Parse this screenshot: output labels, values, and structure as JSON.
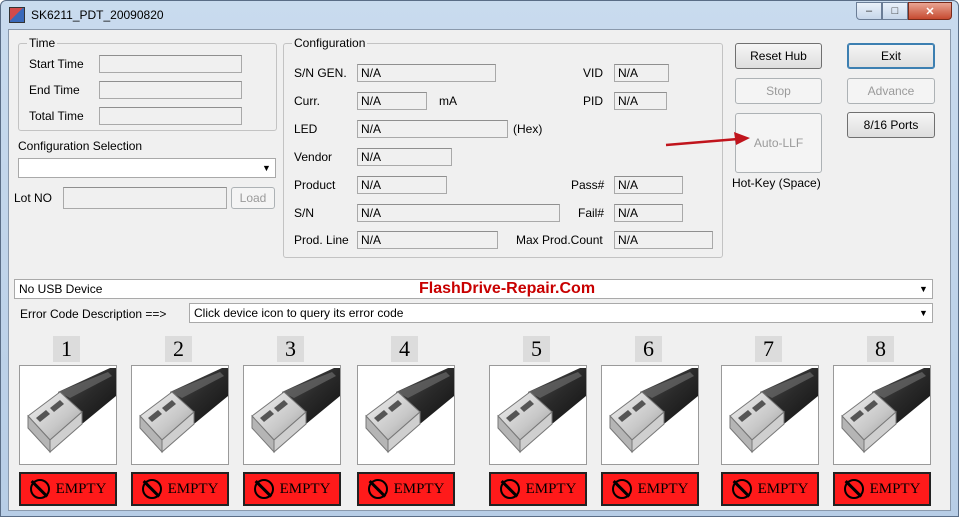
{
  "window": {
    "title": "SK6211_PDT_20090820",
    "minimize": "–",
    "maximize": "□",
    "close": "✕"
  },
  "time": {
    "group_label": "Time",
    "start_label": "Start Time",
    "end_label": "End Time",
    "total_label": "Total Time",
    "start_value": "",
    "end_value": "",
    "total_value": ""
  },
  "config_selection": {
    "label": "Configuration Selection",
    "value": "",
    "lot_label": "Lot NO",
    "lot_value": "",
    "load_button": "Load"
  },
  "configuration": {
    "group_label": "Configuration",
    "sn_gen_label": "S/N GEN.",
    "sn_gen_value": "N/A",
    "curr_label": "Curr.",
    "curr_value": "N/A",
    "curr_unit": "mA",
    "led_label": "LED",
    "led_value": "N/A",
    "led_unit": "(Hex)",
    "vendor_label": "Vendor",
    "vendor_value": "N/A",
    "product_label": "Product",
    "product_value": "N/A",
    "sn_label": "S/N",
    "sn_value": "N/A",
    "prodline_label": "Prod. Line",
    "prodline_value": "N/A",
    "vid_label": "VID",
    "vid_value": "N/A",
    "pid_label": "PID",
    "pid_value": "N/A",
    "pass_label": "Pass#",
    "pass_value": "N/A",
    "fail_label": "Fail#",
    "fail_value": "N/A",
    "maxcount_label": "Max Prod.Count",
    "maxcount_value": "N/A"
  },
  "buttons": {
    "reset_hub": "Reset Hub",
    "stop": "Stop",
    "auto_llf": "Auto-LLF",
    "hotkey": "Hot-Key (Space)",
    "exit": "Exit",
    "advance": "Advance",
    "ports": "8/16 Ports"
  },
  "device_combo": {
    "value": "No USB Device"
  },
  "watermark": "FlashDrive-Repair.Com",
  "error": {
    "label": "Error Code Description ==>",
    "value": "Click device icon to query its error code"
  },
  "ports": [
    {
      "number": "1",
      "status": "EMPTY"
    },
    {
      "number": "2",
      "status": "EMPTY"
    },
    {
      "number": "3",
      "status": "EMPTY"
    },
    {
      "number": "4",
      "status": "EMPTY"
    },
    {
      "number": "5",
      "status": "EMPTY"
    },
    {
      "number": "6",
      "status": "EMPTY"
    },
    {
      "number": "7",
      "status": "EMPTY"
    },
    {
      "number": "8",
      "status": "EMPTY"
    }
  ],
  "colors": {
    "status_empty": "#ff1a1a",
    "arrow": "#c0141c",
    "watermark": "#c80000"
  }
}
